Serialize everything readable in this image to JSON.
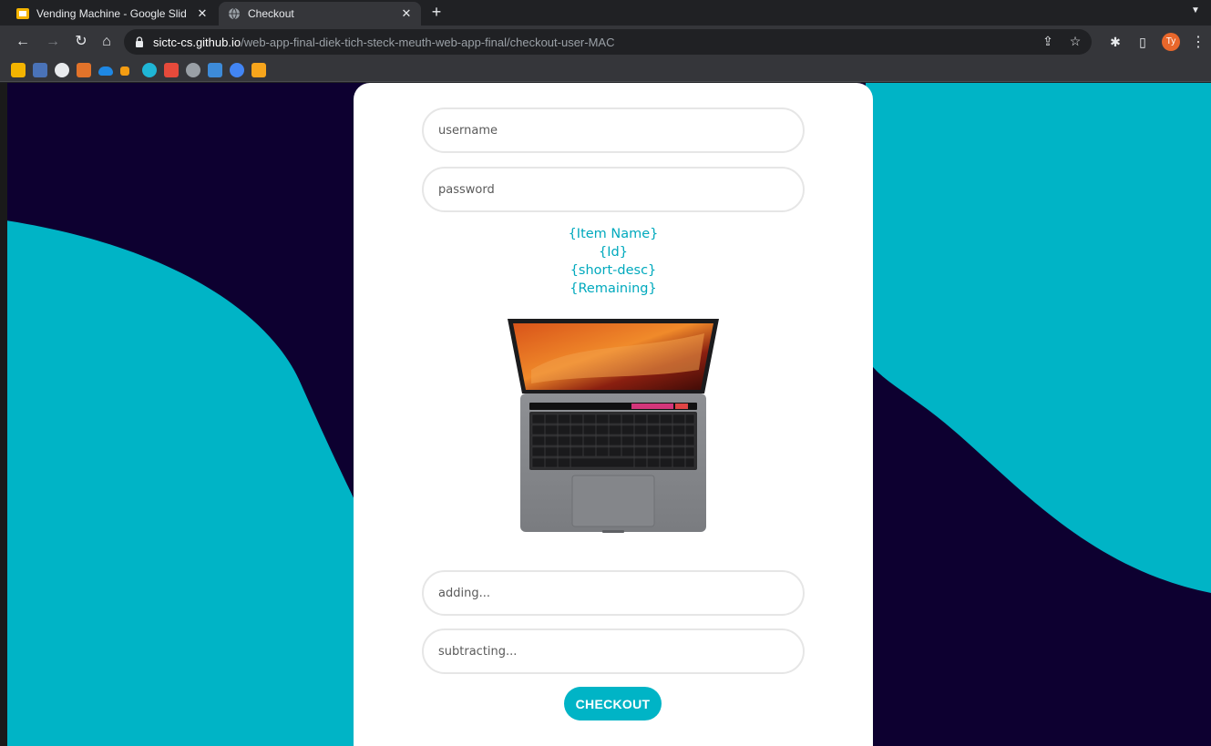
{
  "browser": {
    "tabs": [
      {
        "title": "Vending Machine - Google Slid",
        "active": false,
        "icon": "google-slides-icon"
      },
      {
        "title": "Checkout",
        "active": true,
        "icon": "globe-icon"
      }
    ],
    "tab_close_glyph": "✕",
    "new_tab_glyph": "+",
    "url_host": "sictc-cs.github.io",
    "url_path": "/web-app-final-diek-tich-steck-meuth-web-app-final/checkout-user-MAC",
    "profile_initials": "Ty",
    "bookmarks": [
      "photos-icon",
      "pixlr-icon",
      "github-icon",
      "gitlab-icon",
      "onedrive-icon",
      "scratch-icon",
      "canva-icon",
      "office-icon",
      "chrome-web-icon",
      "app-icon",
      "google-chrome-icon",
      "extension-icon"
    ]
  },
  "colors": {
    "page_dark": "#0d0030",
    "page_teal": "#00b4c6",
    "accent_text": "#00a9bd",
    "button": "#00b4c6"
  },
  "form": {
    "username_placeholder": "username",
    "password_placeholder": "password",
    "adding_placeholder": "adding...",
    "subtracting_placeholder": "subtracting...",
    "checkout_label": "CHECKOUT"
  },
  "item": {
    "name": "{Item Name}",
    "id": "{Id}",
    "short_desc": "{short-desc}",
    "remaining": "{Remaining}",
    "image": "macbook-laptop-image"
  }
}
